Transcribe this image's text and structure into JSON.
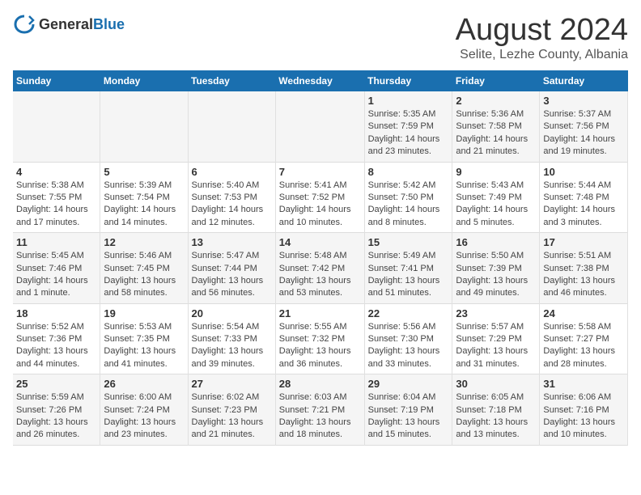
{
  "header": {
    "logo_general": "General",
    "logo_blue": "Blue",
    "title": "August 2024",
    "subtitle": "Selite, Lezhe County, Albania"
  },
  "weekdays": [
    "Sunday",
    "Monday",
    "Tuesday",
    "Wednesday",
    "Thursday",
    "Friday",
    "Saturday"
  ],
  "weeks": [
    [
      {
        "day": "",
        "info": ""
      },
      {
        "day": "",
        "info": ""
      },
      {
        "day": "",
        "info": ""
      },
      {
        "day": "",
        "info": ""
      },
      {
        "day": "1",
        "info": "Sunrise: 5:35 AM\nSunset: 7:59 PM\nDaylight: 14 hours\nand 23 minutes."
      },
      {
        "day": "2",
        "info": "Sunrise: 5:36 AM\nSunset: 7:58 PM\nDaylight: 14 hours\nand 21 minutes."
      },
      {
        "day": "3",
        "info": "Sunrise: 5:37 AM\nSunset: 7:56 PM\nDaylight: 14 hours\nand 19 minutes."
      }
    ],
    [
      {
        "day": "4",
        "info": "Sunrise: 5:38 AM\nSunset: 7:55 PM\nDaylight: 14 hours\nand 17 minutes."
      },
      {
        "day": "5",
        "info": "Sunrise: 5:39 AM\nSunset: 7:54 PM\nDaylight: 14 hours\nand 14 minutes."
      },
      {
        "day": "6",
        "info": "Sunrise: 5:40 AM\nSunset: 7:53 PM\nDaylight: 14 hours\nand 12 minutes."
      },
      {
        "day": "7",
        "info": "Sunrise: 5:41 AM\nSunset: 7:52 PM\nDaylight: 14 hours\nand 10 minutes."
      },
      {
        "day": "8",
        "info": "Sunrise: 5:42 AM\nSunset: 7:50 PM\nDaylight: 14 hours\nand 8 minutes."
      },
      {
        "day": "9",
        "info": "Sunrise: 5:43 AM\nSunset: 7:49 PM\nDaylight: 14 hours\nand 5 minutes."
      },
      {
        "day": "10",
        "info": "Sunrise: 5:44 AM\nSunset: 7:48 PM\nDaylight: 14 hours\nand 3 minutes."
      }
    ],
    [
      {
        "day": "11",
        "info": "Sunrise: 5:45 AM\nSunset: 7:46 PM\nDaylight: 14 hours\nand 1 minute."
      },
      {
        "day": "12",
        "info": "Sunrise: 5:46 AM\nSunset: 7:45 PM\nDaylight: 13 hours\nand 58 minutes."
      },
      {
        "day": "13",
        "info": "Sunrise: 5:47 AM\nSunset: 7:44 PM\nDaylight: 13 hours\nand 56 minutes."
      },
      {
        "day": "14",
        "info": "Sunrise: 5:48 AM\nSunset: 7:42 PM\nDaylight: 13 hours\nand 53 minutes."
      },
      {
        "day": "15",
        "info": "Sunrise: 5:49 AM\nSunset: 7:41 PM\nDaylight: 13 hours\nand 51 minutes."
      },
      {
        "day": "16",
        "info": "Sunrise: 5:50 AM\nSunset: 7:39 PM\nDaylight: 13 hours\nand 49 minutes."
      },
      {
        "day": "17",
        "info": "Sunrise: 5:51 AM\nSunset: 7:38 PM\nDaylight: 13 hours\nand 46 minutes."
      }
    ],
    [
      {
        "day": "18",
        "info": "Sunrise: 5:52 AM\nSunset: 7:36 PM\nDaylight: 13 hours\nand 44 minutes."
      },
      {
        "day": "19",
        "info": "Sunrise: 5:53 AM\nSunset: 7:35 PM\nDaylight: 13 hours\nand 41 minutes."
      },
      {
        "day": "20",
        "info": "Sunrise: 5:54 AM\nSunset: 7:33 PM\nDaylight: 13 hours\nand 39 minutes."
      },
      {
        "day": "21",
        "info": "Sunrise: 5:55 AM\nSunset: 7:32 PM\nDaylight: 13 hours\nand 36 minutes."
      },
      {
        "day": "22",
        "info": "Sunrise: 5:56 AM\nSunset: 7:30 PM\nDaylight: 13 hours\nand 33 minutes."
      },
      {
        "day": "23",
        "info": "Sunrise: 5:57 AM\nSunset: 7:29 PM\nDaylight: 13 hours\nand 31 minutes."
      },
      {
        "day": "24",
        "info": "Sunrise: 5:58 AM\nSunset: 7:27 PM\nDaylight: 13 hours\nand 28 minutes."
      }
    ],
    [
      {
        "day": "25",
        "info": "Sunrise: 5:59 AM\nSunset: 7:26 PM\nDaylight: 13 hours\nand 26 minutes."
      },
      {
        "day": "26",
        "info": "Sunrise: 6:00 AM\nSunset: 7:24 PM\nDaylight: 13 hours\nand 23 minutes."
      },
      {
        "day": "27",
        "info": "Sunrise: 6:02 AM\nSunset: 7:23 PM\nDaylight: 13 hours\nand 21 minutes."
      },
      {
        "day": "28",
        "info": "Sunrise: 6:03 AM\nSunset: 7:21 PM\nDaylight: 13 hours\nand 18 minutes."
      },
      {
        "day": "29",
        "info": "Sunrise: 6:04 AM\nSunset: 7:19 PM\nDaylight: 13 hours\nand 15 minutes."
      },
      {
        "day": "30",
        "info": "Sunrise: 6:05 AM\nSunset: 7:18 PM\nDaylight: 13 hours\nand 13 minutes."
      },
      {
        "day": "31",
        "info": "Sunrise: 6:06 AM\nSunset: 7:16 PM\nDaylight: 13 hours\nand 10 minutes."
      }
    ]
  ]
}
